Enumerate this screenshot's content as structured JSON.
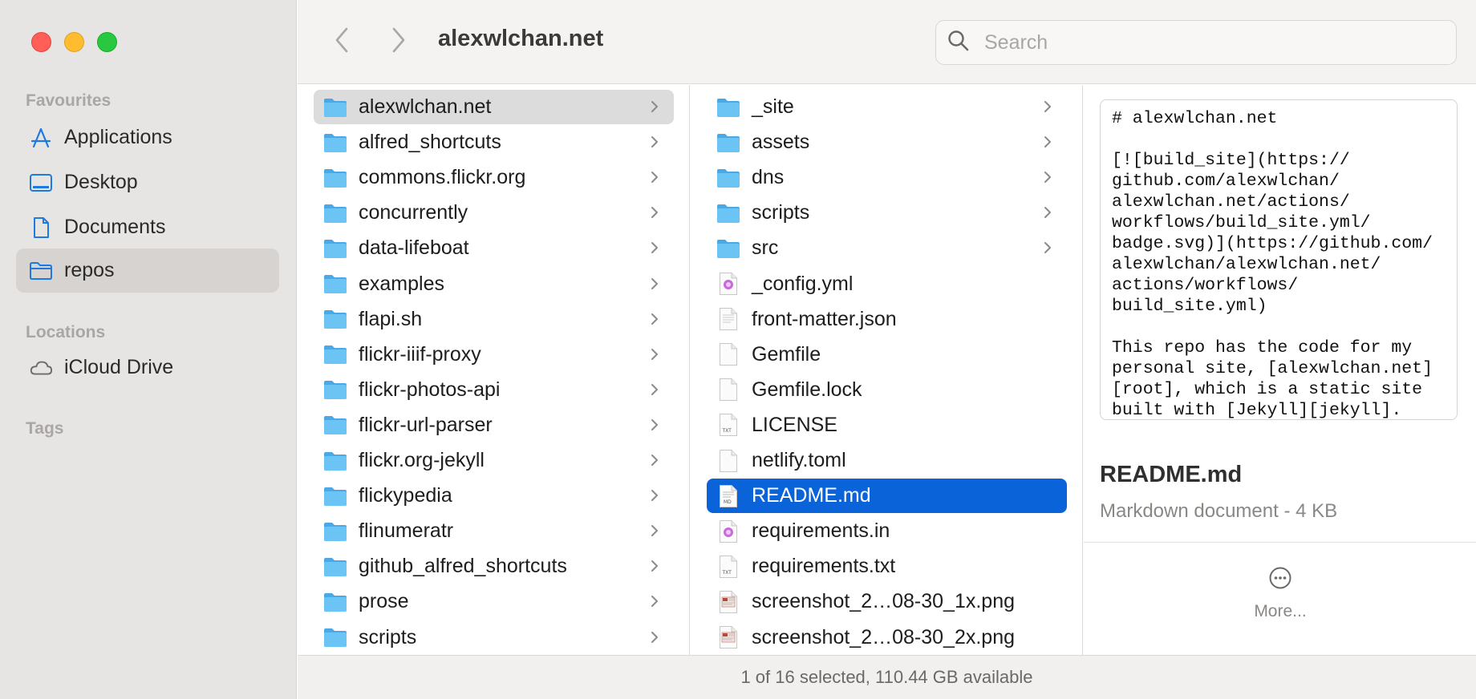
{
  "window": {
    "title": "alexwlchan.net",
    "search": {
      "placeholder": "Search"
    }
  },
  "sidebar": {
    "sections": [
      {
        "label": "Favourites"
      },
      {
        "label": "Locations"
      },
      {
        "label": "Tags"
      }
    ],
    "favourites": [
      {
        "label": "Applications",
        "icon": "applications-icon"
      },
      {
        "label": "Desktop",
        "icon": "desktop-icon"
      },
      {
        "label": "Documents",
        "icon": "document-icon"
      },
      {
        "label": "repos",
        "icon": "folder-icon",
        "selected": true
      }
    ],
    "locations": [
      {
        "label": "iCloud Drive",
        "icon": "cloud-icon"
      }
    ]
  },
  "columns": {
    "repos": [
      {
        "name": "alexwlchan.net",
        "selected": true
      },
      {
        "name": "alfred_shortcuts"
      },
      {
        "name": "commons.flickr.org"
      },
      {
        "name": "concurrently"
      },
      {
        "name": "data-lifeboat"
      },
      {
        "name": "examples"
      },
      {
        "name": "flapi.sh"
      },
      {
        "name": "flickr-iiif-proxy"
      },
      {
        "name": "flickr-photos-api"
      },
      {
        "name": "flickr-url-parser"
      },
      {
        "name": "flickr.org-jekyll"
      },
      {
        "name": "flickypedia"
      },
      {
        "name": "flinumeratr"
      },
      {
        "name": "github_alfred_shortcuts"
      },
      {
        "name": "prose"
      },
      {
        "name": "scripts"
      }
    ],
    "project": [
      {
        "name": "_site",
        "kind": "folder"
      },
      {
        "name": "assets",
        "kind": "folder"
      },
      {
        "name": "dns",
        "kind": "folder"
      },
      {
        "name": "scripts",
        "kind": "folder"
      },
      {
        "name": "src",
        "kind": "folder"
      },
      {
        "name": "_config.yml",
        "kind": "yml"
      },
      {
        "name": "front-matter.json",
        "kind": "json"
      },
      {
        "name": "Gemfile",
        "kind": "blank"
      },
      {
        "name": "Gemfile.lock",
        "kind": "blank"
      },
      {
        "name": "LICENSE",
        "kind": "txt"
      },
      {
        "name": "netlify.toml",
        "kind": "blank"
      },
      {
        "name": "README.md",
        "kind": "md",
        "selected": true
      },
      {
        "name": "requirements.in",
        "kind": "yml"
      },
      {
        "name": "requirements.txt",
        "kind": "txt"
      },
      {
        "name": "screenshot_2…08-30_1x.png",
        "kind": "png"
      },
      {
        "name": "screenshot_2…08-30_2x.png",
        "kind": "png"
      }
    ]
  },
  "preview": {
    "content": "# alexwlchan.net\n\n[![build_site](https://\ngithub.com/alexwlchan/\nalexwlchan.net/actions/\nworkflows/build_site.yml/\nbadge.svg)](https://github.com/\nalexwlchan/alexwlchan.net/\nactions/workflows/\nbuild_site.yml)\n\nThis repo has the code for my\npersonal site, [alexwlchan.net]\n[root], which is a static site\nbuilt with [Jekyll][jekyll].",
    "file_name": "README.md",
    "file_kind": "Markdown document - 4 KB",
    "more_label": "More..."
  },
  "status_bar": {
    "text": "1 of 16 selected, 110.44 GB available"
  },
  "colors": {
    "selection_blue": "#0a63d8",
    "folder_blue": "#5ab8f0",
    "sidebar_bg": "#e7e5e4"
  }
}
